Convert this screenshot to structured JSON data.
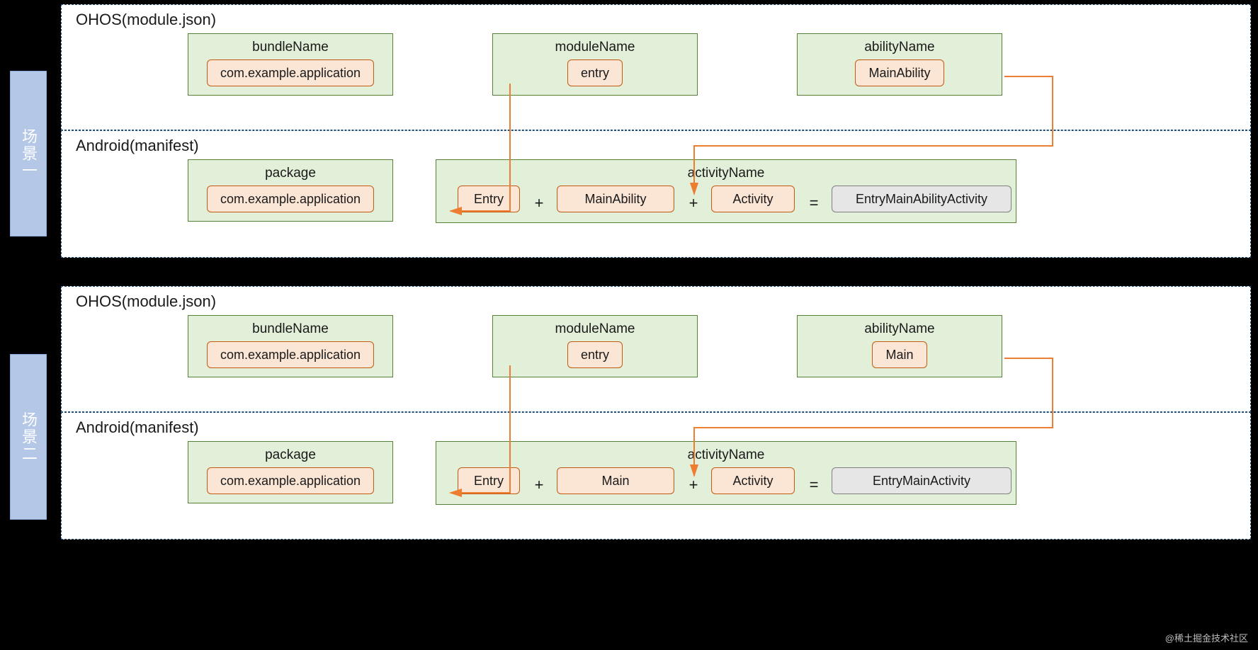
{
  "sidebar": {
    "label1": "场景一",
    "label2": "场景二"
  },
  "s1": {
    "ohos": {
      "title": "OHOS(module.json)",
      "bundle": {
        "title": "bundleName",
        "value": "com.example.application"
      },
      "module": {
        "title": "moduleName",
        "value": "entry"
      },
      "ability": {
        "title": "abilityName",
        "value": "MainAbility"
      }
    },
    "android": {
      "title": "Android(manifest)",
      "package": {
        "title": "package",
        "value": "com.example.application"
      },
      "activity": {
        "title": "activityName",
        "p1": "Entry",
        "p2": "MainAbility",
        "p3": "Activity",
        "result": "EntryMainAbilityActivity",
        "plus": "+",
        "eq": "="
      }
    }
  },
  "s2": {
    "ohos": {
      "title": "OHOS(module.json)",
      "bundle": {
        "title": "bundleName",
        "value": "com.example.application"
      },
      "module": {
        "title": "moduleName",
        "value": "entry"
      },
      "ability": {
        "title": "abilityName",
        "value": "Main"
      }
    },
    "android": {
      "title": "Android(manifest)",
      "package": {
        "title": "package",
        "value": "com.example.application"
      },
      "activity": {
        "title": "activityName",
        "p1": "Entry",
        "p2": "Main",
        "p3": "Activity",
        "result": "EntryMainActivity",
        "plus": "+",
        "eq": "="
      }
    }
  },
  "watermark": "@稀土掘金技术社区"
}
